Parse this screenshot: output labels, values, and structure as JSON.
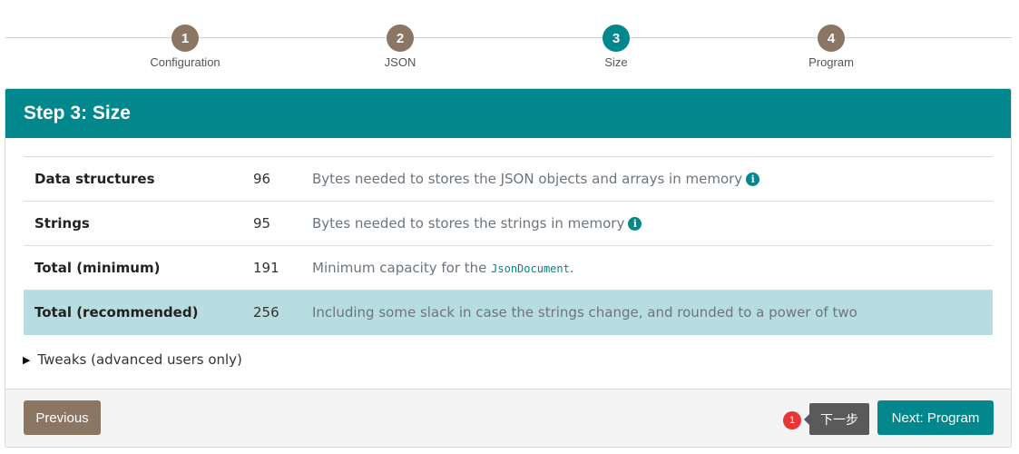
{
  "stepper": {
    "steps": [
      {
        "number": "1",
        "label": "Configuration",
        "active": false
      },
      {
        "number": "2",
        "label": "JSON",
        "active": false
      },
      {
        "number": "3",
        "label": "Size",
        "active": true
      },
      {
        "number": "4",
        "label": "Program",
        "active": false
      }
    ]
  },
  "card": {
    "title": "Step 3: Size",
    "rows": [
      {
        "label": "Data structures",
        "value": "96",
        "description": "Bytes needed to stores the JSON objects and arrays in memory",
        "has_info_icon": true
      },
      {
        "label": "Strings",
        "value": "95",
        "description": "Bytes needed to stores the strings in memory",
        "has_info_icon": true
      },
      {
        "label": "Total (minimum)",
        "value": "191",
        "description_prefix": "Minimum capacity for the ",
        "description_code": "JsonDocument",
        "description_suffix": ".",
        "has_info_icon": false
      },
      {
        "label": "Total (recommended)",
        "value": "256",
        "description": "Including some slack in case the strings change, and rounded to a power of two",
        "highlighted": true
      }
    ],
    "tweaks_label": "Tweaks (advanced users only)",
    "info_icon_glyph": "i"
  },
  "footer": {
    "previous_label": "Previous",
    "next_label": "Next: Program",
    "badge_count": "1",
    "tooltip_text": "下一步"
  },
  "colors": {
    "accent": "#02878c",
    "secondary": "#8b7664",
    "highlight_row": "#b8dde0",
    "badge": "#e83535",
    "tooltip_bg": "#5a5a5a"
  },
  "icons": {
    "info": "info-icon",
    "disclosure": "disclosure-triangle-icon"
  }
}
